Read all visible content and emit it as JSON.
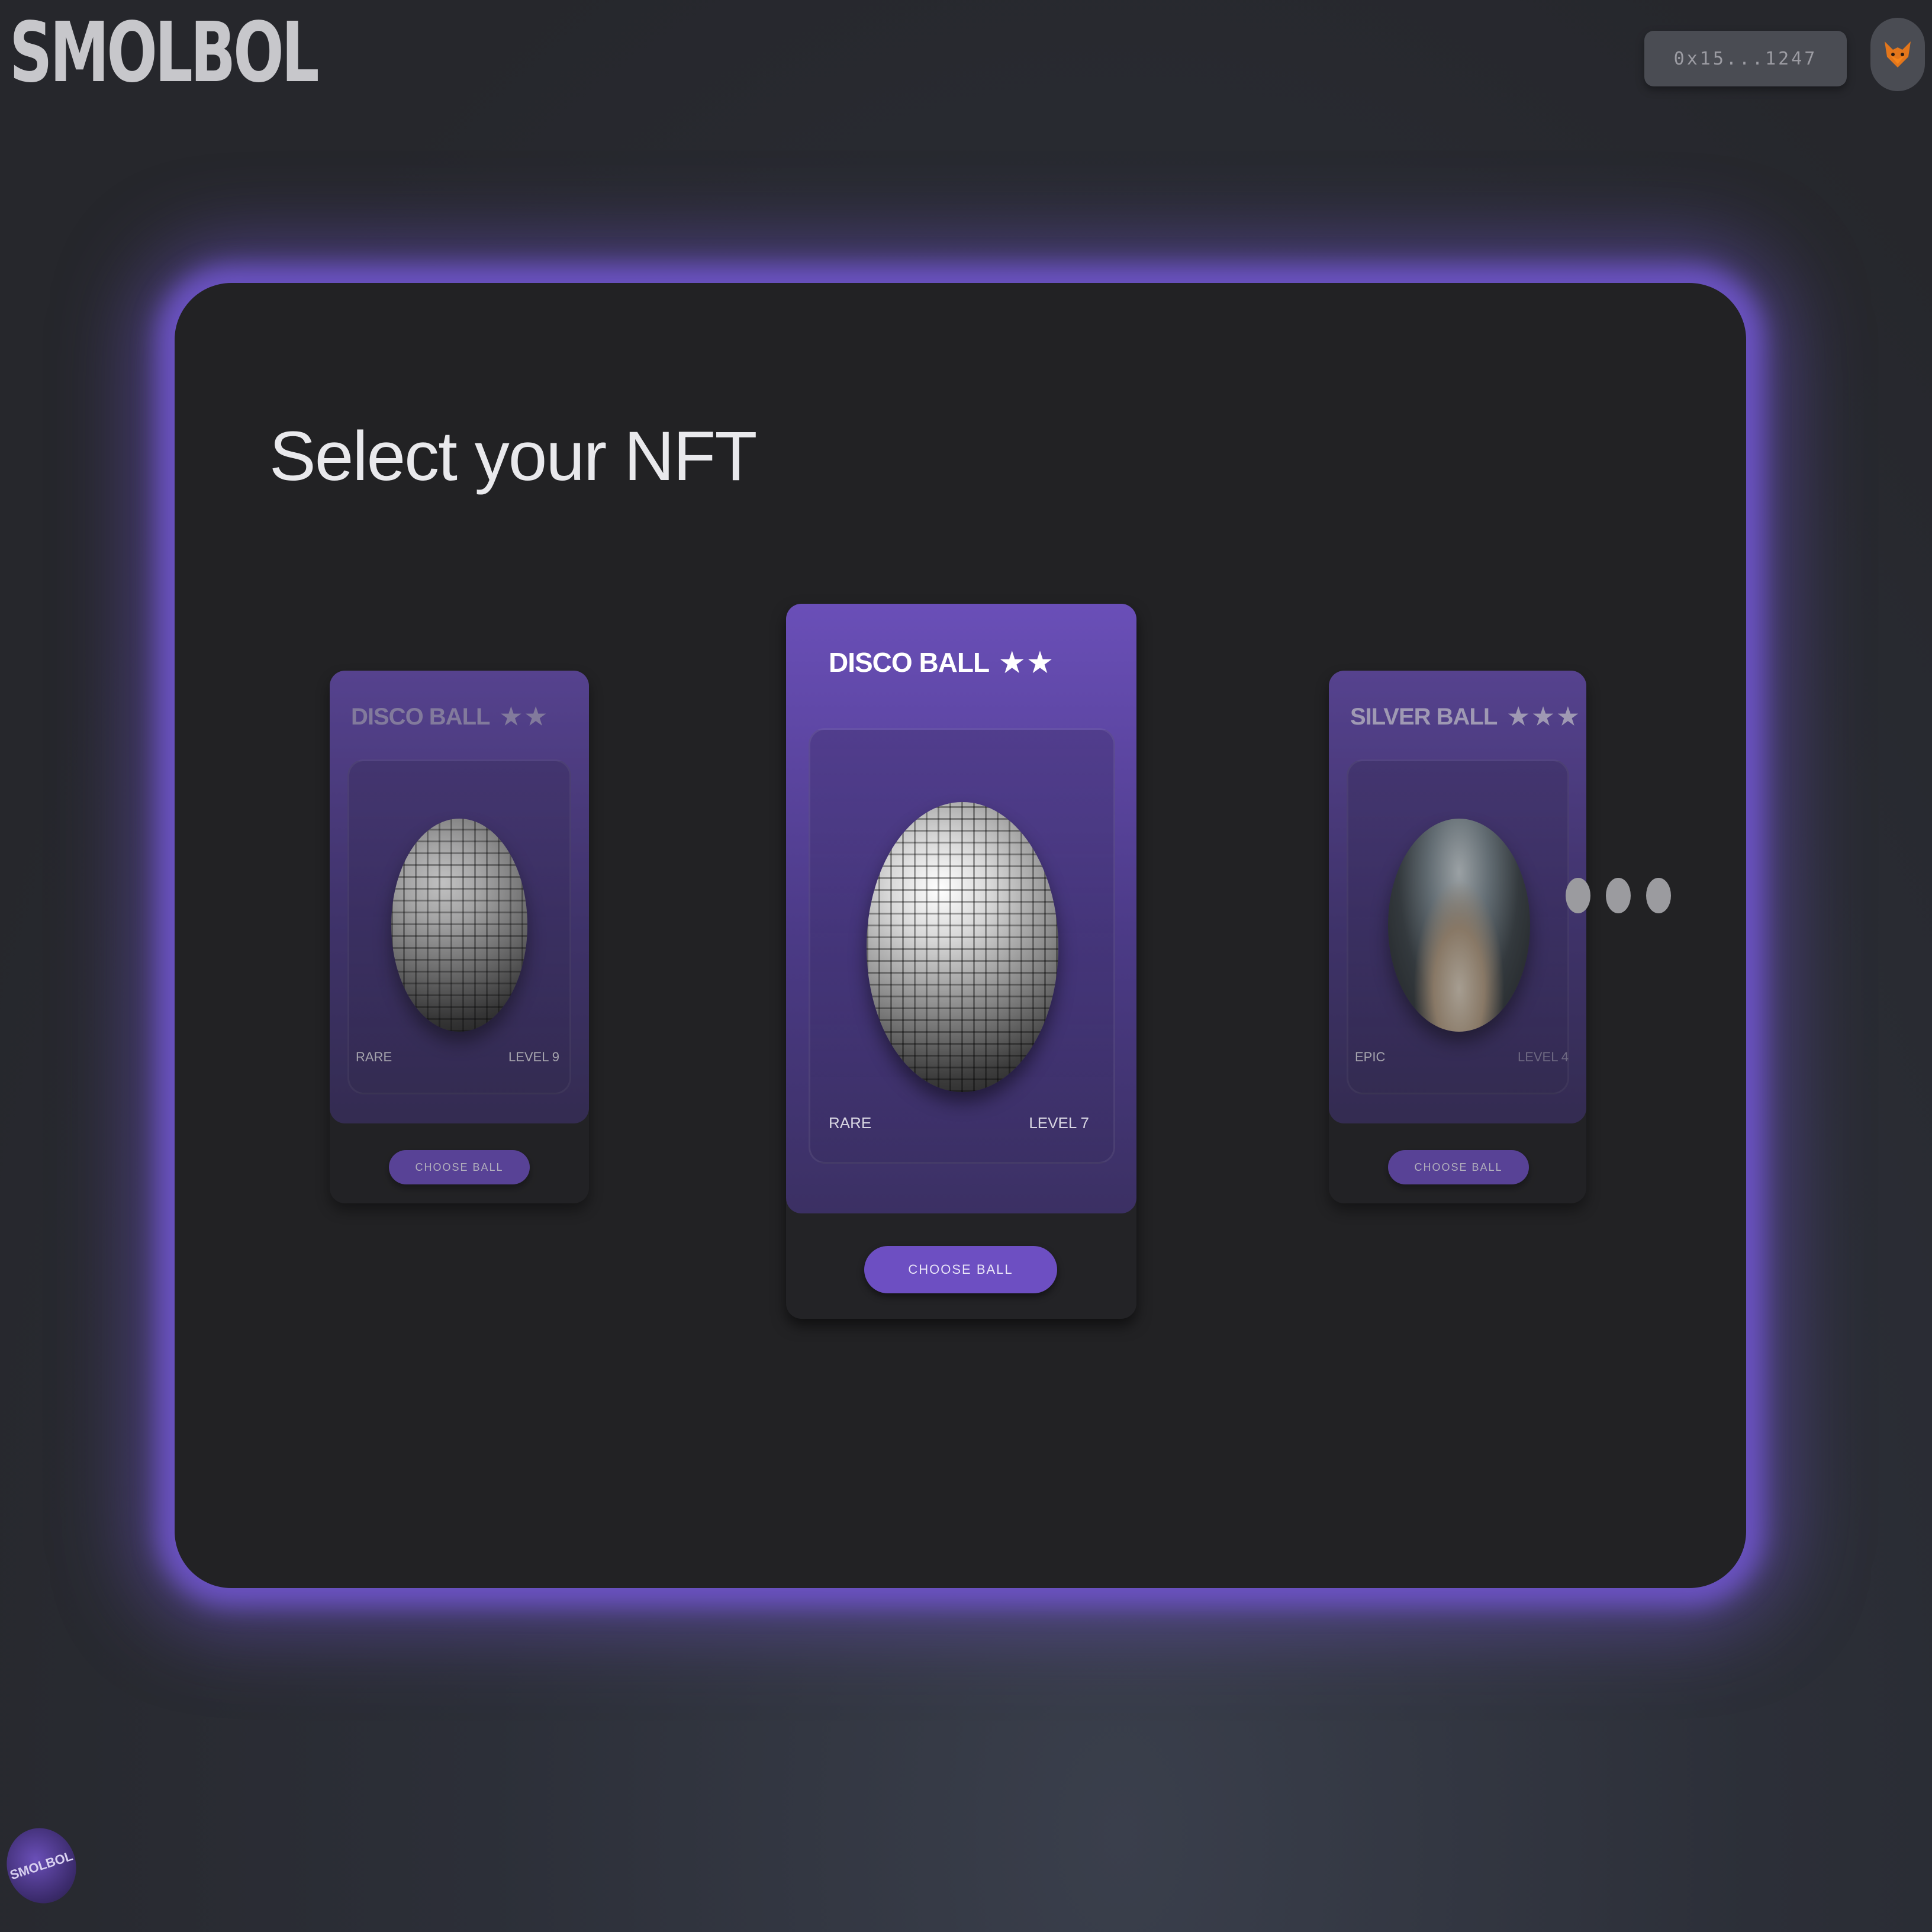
{
  "header": {
    "logo_text": "SMOLBOL",
    "wallet_address": "0x15...1247",
    "avatar_icon": "fox-icon"
  },
  "main": {
    "title": "Select your NFT",
    "cards": [
      {
        "name": "DISCO BALL",
        "stars": "★★",
        "rarity": "RARE",
        "level": "LEVEL 9",
        "button_label": "CHOOSE BALL",
        "ball_image": "disco-ball"
      },
      {
        "name": "DISCO BALL",
        "stars": "★★",
        "rarity": "RARE",
        "level": "LEVEL 7",
        "button_label": "CHOOSE BALL",
        "ball_image": "disco-ball"
      },
      {
        "name": "SILVER BALL",
        "stars": "★★★",
        "rarity": "EPIC",
        "level": "LEVEL 4",
        "button_label": "CHOOSE BALL",
        "ball_image": "silver-ball"
      }
    ],
    "pagination": {
      "count": 3
    }
  },
  "footer": {
    "badge_text": "SMOLBOL"
  },
  "colors": {
    "accent": "#6d4fc2",
    "glow": "#6a52c0",
    "panel": "#222224",
    "background": "#2a2c33"
  }
}
